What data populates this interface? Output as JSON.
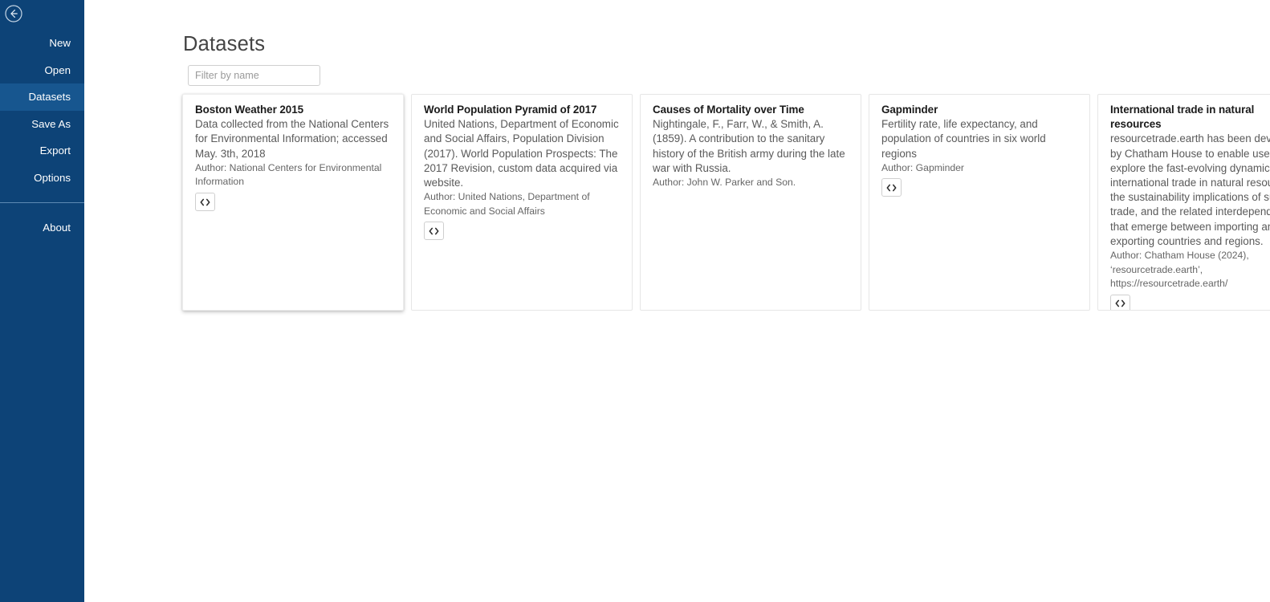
{
  "sidebar": {
    "back_button_icon": "circle-arrow-left-icon",
    "items": [
      {
        "label": "New",
        "name": "new",
        "selected": false
      },
      {
        "label": "Open",
        "name": "open",
        "selected": false
      },
      {
        "label": "Datasets",
        "name": "datasets",
        "selected": true
      },
      {
        "label": "Save As",
        "name": "save-as",
        "selected": false
      },
      {
        "label": "Export",
        "name": "export",
        "selected": false
      },
      {
        "label": "Options",
        "name": "options",
        "selected": false
      }
    ],
    "footer_items": [
      {
        "label": "About",
        "name": "about",
        "selected": false
      }
    ],
    "colors": {
      "background": "#0d4377",
      "selected": "#17568f",
      "text": "#ffffff",
      "separator": "#5d8ab3"
    }
  },
  "main": {
    "title": "Datasets",
    "filter": {
      "placeholder": "Filter by name",
      "value": ""
    },
    "code_button_icon": "code-angle-brackets-icon",
    "cards": [
      {
        "title": "Boston Weather 2015",
        "description": "Data collected from the National Centers for Environmental Information; accessed May. 3th, 2018",
        "author": "Author: National Centers for Environmental Information",
        "has_code_button": true,
        "elevated": true
      },
      {
        "title": "World Population Pyramid of 2017",
        "description": "United Nations, Department of Economic and Social Affairs, Population Division (2017). World Population Prospects: The 2017 Revision, custom data acquired via website.",
        "author": "Author: United Nations, Department of Economic and Social Affairs",
        "has_code_button": true,
        "elevated": false
      },
      {
        "title": "Causes of Mortality over Time",
        "description": "Nightingale, F., Farr, W., & Smith, A. (1859). A contribution to the sanitary history of the British army during the late war with Russia.",
        "author": "Author: John W. Parker and Son.",
        "has_code_button": false,
        "elevated": false
      },
      {
        "title": "Gapminder",
        "description": "Fertility rate, life expectancy, and population of countries in six world regions",
        "author": "Author: Gapminder",
        "has_code_button": true,
        "elevated": false
      },
      {
        "title": "International trade in natural resources",
        "description": "resourcetrade.earth has been developed by Chatham House to enable users to explore the fast-evolving dynamics of international trade in natural resources, the sustainability implications of such trade, and the related interdependencies that emerge between importing and exporting countries and regions.",
        "author": "Author: Chatham House (2024), ‘resourcetrade.earth’, https://resourcetrade.earth/",
        "has_code_button": true,
        "elevated": false
      }
    ]
  }
}
